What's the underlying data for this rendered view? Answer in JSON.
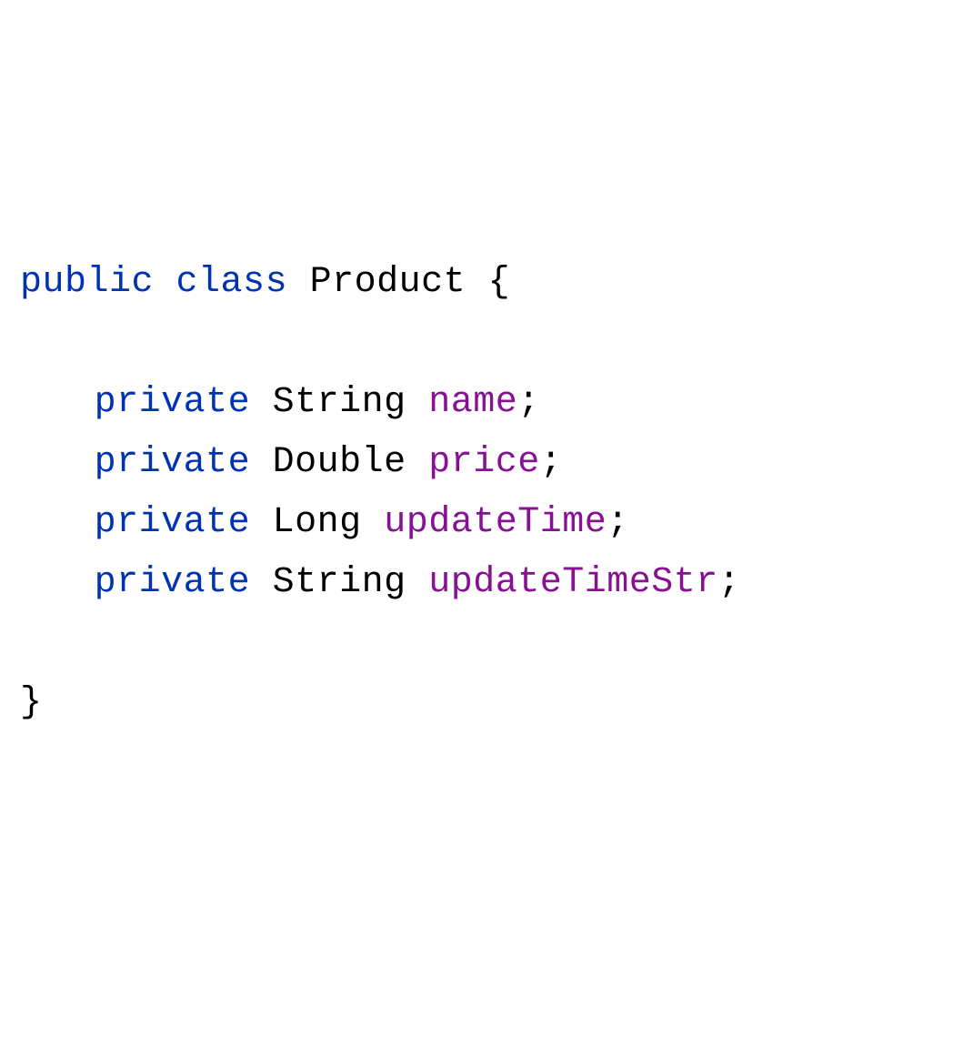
{
  "code": {
    "kw_public": "public",
    "kw_class": "class",
    "class_name": "Product",
    "brace_open": "{",
    "brace_close": "}",
    "semicolon": ";",
    "kw_private": "private",
    "fields": [
      {
        "type": "String",
        "name": "name"
      },
      {
        "type": "Double",
        "name": "price"
      },
      {
        "type": "Long",
        "name": "updateTime"
      },
      {
        "type": "String",
        "name": "updateTimeStr"
      }
    ]
  }
}
